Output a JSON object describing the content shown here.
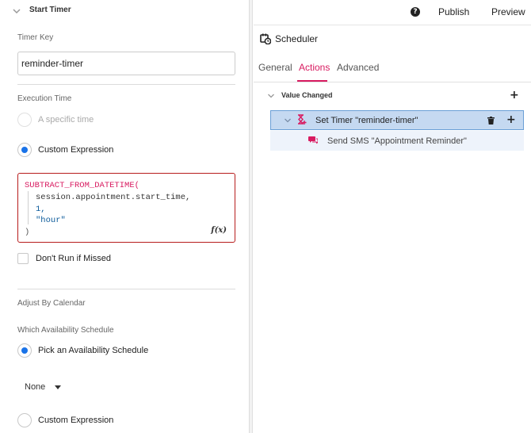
{
  "left_panel": {
    "section_title": "Start Timer",
    "timer_key": {
      "label": "Timer Key",
      "value": "reminder-timer"
    },
    "execution_time": {
      "label": "Execution Time",
      "options": [
        {
          "label": "A specific time",
          "selected": false,
          "disabled": true
        },
        {
          "label": "Custom Expression",
          "selected": true,
          "disabled": false
        }
      ]
    },
    "code": {
      "line1": "SUBTRACT_FROM_DATETIME(",
      "line2": "session.appointment.start_time,",
      "line3": "1,",
      "line4": "\"hour\"",
      "line5": ")",
      "fx_label": "f(x)"
    },
    "dont_run_if_missed": {
      "label": "Don't Run if Missed",
      "checked": false
    },
    "adjust_by_calendar": {
      "label": "Adjust By Calendar"
    },
    "which_schedule": {
      "label": "Which Availability Schedule",
      "options": [
        {
          "label": "Pick an Availability Schedule",
          "selected": true
        },
        {
          "label": "Custom Expression",
          "selected": false
        }
      ],
      "dropdown_value": "None"
    }
  },
  "topbar": {
    "publish_label": "Publish",
    "preview_label": "Preview"
  },
  "right_panel": {
    "title": "Scheduler",
    "tabs": [
      {
        "label": "General",
        "active": false
      },
      {
        "label": "Actions",
        "active": true
      },
      {
        "label": "Advanced",
        "active": false
      }
    ],
    "tree": {
      "trigger": "Value Changed",
      "selected_node": "Set Timer \"reminder-timer\"",
      "child_node": "Send SMS \"Appointment Reminder\""
    }
  },
  "colors": {
    "accent": "#d81b60",
    "radio_selected": "#1a73e8",
    "selected_row_bg": "#c5d9f1",
    "child_row_bg": "#eef3fb",
    "error_border": "#b71c1c"
  },
  "icons": [
    "chevron-down-icon",
    "help-icon",
    "calendar-clock-icon",
    "hourglass-icon",
    "trash-icon",
    "plus-icon",
    "sms-icon",
    "fx-icon"
  ]
}
